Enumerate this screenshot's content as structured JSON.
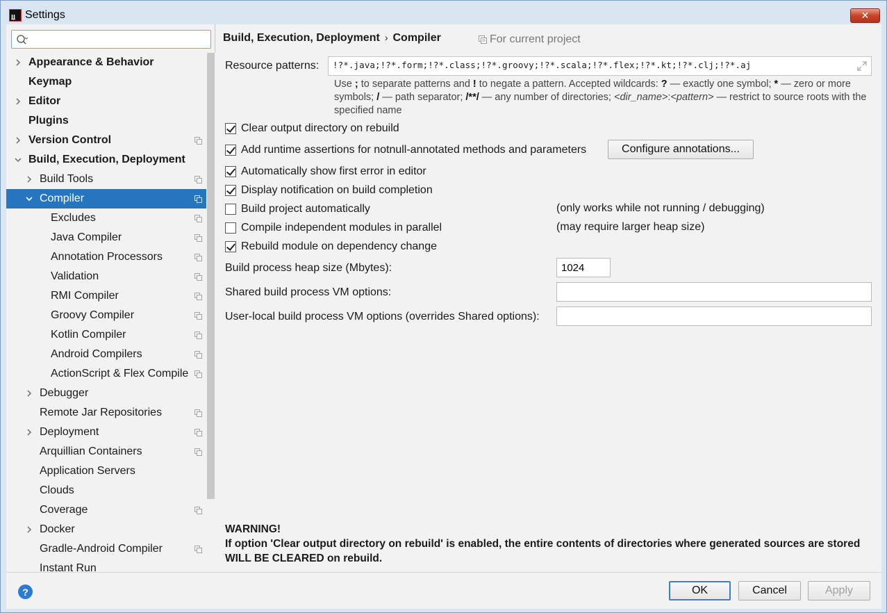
{
  "window": {
    "title": "Settings",
    "app_icon_text": "IJ",
    "close_glyph": "✕"
  },
  "search": {
    "placeholder": "",
    "value": ""
  },
  "tree": [
    {
      "label": "Appearance & Behavior",
      "depth": 0,
      "bold": true,
      "arrow": "right",
      "proj": false
    },
    {
      "label": "Keymap",
      "depth": 0,
      "bold": true,
      "arrow": "none",
      "proj": false
    },
    {
      "label": "Editor",
      "depth": 0,
      "bold": true,
      "arrow": "right",
      "proj": false
    },
    {
      "label": "Plugins",
      "depth": 0,
      "bold": true,
      "arrow": "none",
      "proj": false
    },
    {
      "label": "Version Control",
      "depth": 0,
      "bold": true,
      "arrow": "right",
      "proj": true
    },
    {
      "label": "Build, Execution, Deployment",
      "depth": 0,
      "bold": true,
      "arrow": "down",
      "proj": false
    },
    {
      "label": "Build Tools",
      "depth": 1,
      "bold": false,
      "arrow": "right",
      "proj": true
    },
    {
      "label": "Compiler",
      "depth": 1,
      "bold": false,
      "arrow": "down",
      "proj": true,
      "selected": true
    },
    {
      "label": "Excludes",
      "depth": 2,
      "bold": false,
      "arrow": "none",
      "proj": true
    },
    {
      "label": "Java Compiler",
      "depth": 2,
      "bold": false,
      "arrow": "none",
      "proj": true
    },
    {
      "label": "Annotation Processors",
      "depth": 2,
      "bold": false,
      "arrow": "none",
      "proj": true
    },
    {
      "label": "Validation",
      "depth": 2,
      "bold": false,
      "arrow": "none",
      "proj": true
    },
    {
      "label": "RMI Compiler",
      "depth": 2,
      "bold": false,
      "arrow": "none",
      "proj": true
    },
    {
      "label": "Groovy Compiler",
      "depth": 2,
      "bold": false,
      "arrow": "none",
      "proj": true
    },
    {
      "label": "Kotlin Compiler",
      "depth": 2,
      "bold": false,
      "arrow": "none",
      "proj": true
    },
    {
      "label": "Android Compilers",
      "depth": 2,
      "bold": false,
      "arrow": "none",
      "proj": true
    },
    {
      "label": "ActionScript & Flex Compile",
      "depth": 2,
      "bold": false,
      "arrow": "none",
      "proj": true
    },
    {
      "label": "Debugger",
      "depth": 1,
      "bold": false,
      "arrow": "right",
      "proj": false
    },
    {
      "label": "Remote Jar Repositories",
      "depth": 1,
      "bold": false,
      "arrow": "none",
      "proj": true
    },
    {
      "label": "Deployment",
      "depth": 1,
      "bold": false,
      "arrow": "right",
      "proj": true
    },
    {
      "label": "Arquillian Containers",
      "depth": 1,
      "bold": false,
      "arrow": "none",
      "proj": true
    },
    {
      "label": "Application Servers",
      "depth": 1,
      "bold": false,
      "arrow": "none",
      "proj": false
    },
    {
      "label": "Clouds",
      "depth": 1,
      "bold": false,
      "arrow": "none",
      "proj": false
    },
    {
      "label": "Coverage",
      "depth": 1,
      "bold": false,
      "arrow": "none",
      "proj": true
    },
    {
      "label": "Docker",
      "depth": 1,
      "bold": false,
      "arrow": "right",
      "proj": false
    },
    {
      "label": "Gradle-Android Compiler",
      "depth": 1,
      "bold": false,
      "arrow": "none",
      "proj": true
    },
    {
      "label": "Instant Run",
      "depth": 1,
      "bold": false,
      "arrow": "none",
      "proj": false
    }
  ],
  "breadcrumb": {
    "parent": "Build, Execution, Deployment",
    "separator": "›",
    "current": "Compiler"
  },
  "for_project": "For current project",
  "resource_patterns": {
    "label": "Resource patterns:",
    "value": "!?*.java;!?*.form;!?*.class;!?*.groovy;!?*.scala;!?*.flex;!?*.kt;!?*.clj;!?*.aj"
  },
  "hint": {
    "t1": "Use ",
    "b1": ";",
    "t2": " to separate patterns and ",
    "b2": "!",
    "t3": " to negate a pattern. Accepted wildcards: ",
    "b3": "?",
    "t4": " — exactly one symbol; ",
    "b4": "*",
    "t5": " — zero or more symbols; ",
    "b5": "/",
    "t6": " — path separator; ",
    "b6": "/**/",
    "t7": " — any number of directories; ",
    "i1": "<dir_name>",
    "t8": ":",
    "i2": "<pattern>",
    "t9": " — restrict to source roots with the specified name"
  },
  "options": [
    {
      "label": "Clear output directory on rebuild",
      "checked": true,
      "note": ""
    },
    {
      "label": "Add runtime assertions for notnull-annotated methods and parameters",
      "checked": true,
      "note": ""
    },
    {
      "label": "Automatically show first error in editor",
      "checked": true,
      "note": ""
    },
    {
      "label": "Display notification on build completion",
      "checked": true,
      "note": ""
    },
    {
      "label": "Build project automatically",
      "checked": false,
      "note": "(only works while not running / debugging)"
    },
    {
      "label": "Compile independent modules in parallel",
      "checked": false,
      "note": "(may require larger heap size)"
    },
    {
      "label": "Rebuild module on dependency change",
      "checked": true,
      "note": ""
    }
  ],
  "configure_annotations_label": "Configure annotations...",
  "heap": {
    "label": "Build process heap size (Mbytes):",
    "value": "1024"
  },
  "shared_vm": {
    "label": "Shared build process VM options:",
    "value": ""
  },
  "user_vm": {
    "label": "User-local build process VM options (overrides Shared options):",
    "value": ""
  },
  "warning": {
    "title": "WARNING!",
    "text": "If option 'Clear output directory on rebuild' is enabled, the entire contents of directories where generated sources are stored WILL BE CLEARED on rebuild."
  },
  "footer": {
    "help": "?",
    "ok": "OK",
    "cancel": "Cancel",
    "apply": "Apply"
  },
  "colors": {
    "selection": "#2675bf",
    "help": "#2b7bd1",
    "close": "#c7432a"
  }
}
